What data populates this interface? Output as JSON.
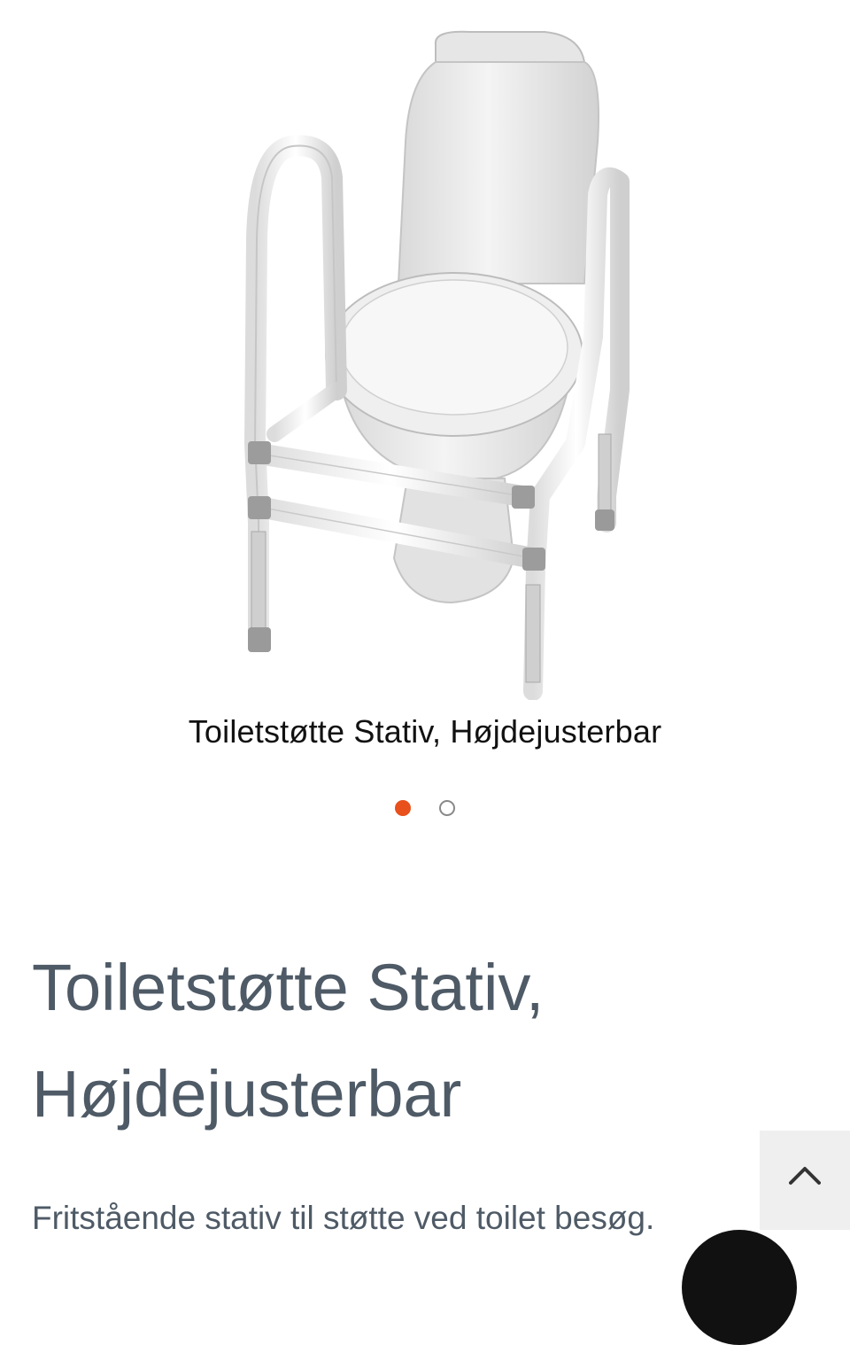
{
  "product": {
    "image_caption": "Toiletstøtte Stativ, Højdejusterbar",
    "title": "Toiletstøtte Stativ, Højdejusterbar",
    "description": "Fritstående stativ til støtte ved toilet besøg."
  },
  "carousel": {
    "slide_count": 2,
    "active_index": 0,
    "active_color": "#e8501c"
  },
  "icons": {
    "scroll_top": "chevron-up-icon",
    "chat": "chat-bubble-icon"
  }
}
